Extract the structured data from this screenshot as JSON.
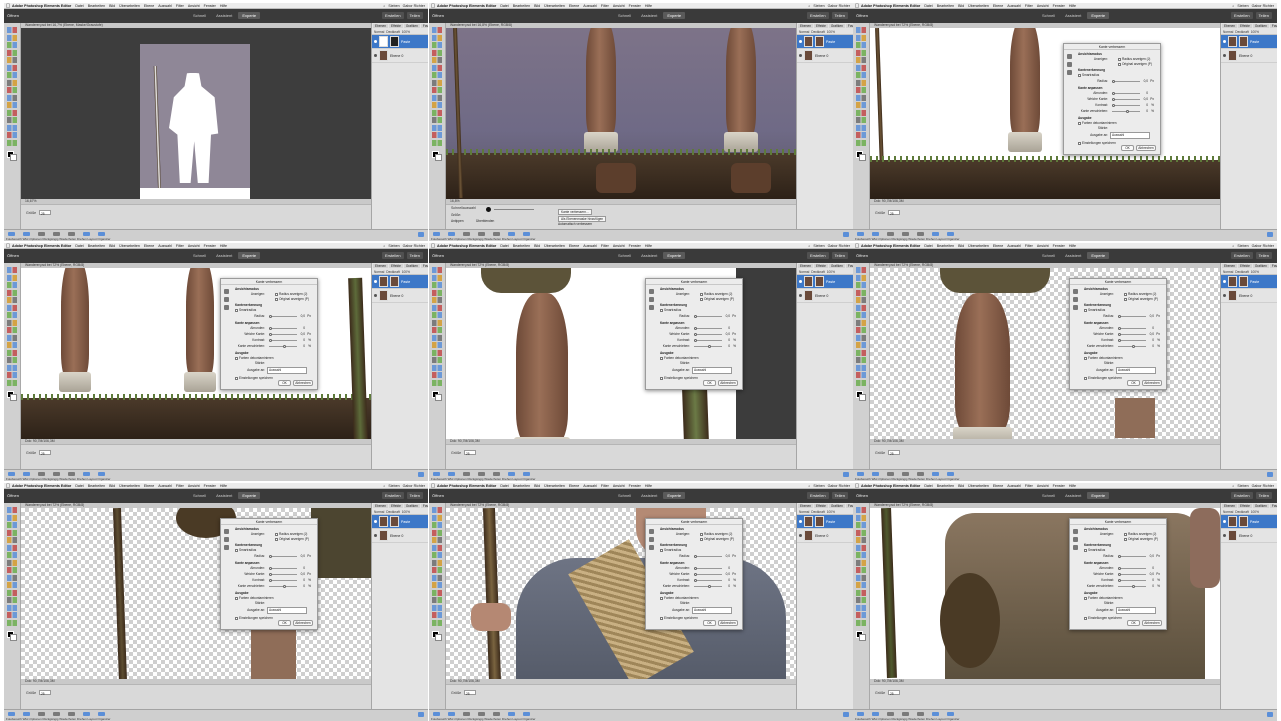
{
  "app": {
    "menu": [
      "Adobe Photoshop Elements Editor",
      "Datei",
      "Bearbeiten",
      "Bild",
      "Überarbeiten",
      "Ebene",
      "Auswahl",
      "Filter",
      "Ansicht",
      "Fenster",
      "Hilfe"
    ],
    "menu_right": [
      "Sieben",
      "Gabor Richter"
    ],
    "open_label": "Öffnen",
    "modes": [
      "Schnell",
      "Assistent",
      "Experte"
    ],
    "active_mode": "Experte",
    "right_actions": [
      "Erstellen",
      "Teilen"
    ],
    "panel_tabs": [
      "Ebenen",
      "Effekte",
      "Grafiken",
      "Favoriten"
    ],
    "layer_tools": [
      "Normal",
      "Deckkraft",
      "100%"
    ],
    "layers": [
      {
        "name": "Paste"
      },
      {
        "name": "Ebene 0"
      }
    ],
    "taskbar_labels": "Fotobereich  Wkz-Optionen  Rückgängig  Wiederholen  Drehen  Layout  Organizer",
    "colors": {
      "selection": "#3d78c8",
      "modebar": "#3a3a3a"
    }
  },
  "panels": [
    {
      "id": 1,
      "doc_title": "Wanderer.psd bei 16,7% (Ebene, Maske/Graustufe)",
      "status": "16,67%",
      "options_label": "Größe",
      "options_value": "25"
    },
    {
      "id": 2,
      "doc_title": "Wanderer.psd bei 16,8% (Ebene, RGB/8)",
      "status": "16,8%",
      "options_label": "Schnellauswahl",
      "options_value": "",
      "options_extra": [
        "Größe:",
        "Antippen",
        "Überblenden",
        "Kante verbessern...",
        "Als Ebenenmaske hinzufügen",
        "Automatisch verbessern"
      ]
    },
    {
      "id": 3,
      "doc_title": "Wanderer.psd bei 72% (Ebene, RGB/8)",
      "status": "Dok: 90,7M/106,3M",
      "options_label": "Größe",
      "options_value": "25"
    },
    {
      "id": 4,
      "doc_title": "Wanderer.psd bei 72% (Ebene, RGB/8)",
      "status": "Dok: 90,7M/106,3M",
      "options_label": "Größe",
      "options_value": "25"
    },
    {
      "id": 5,
      "doc_title": "Wanderer.psd bei 72% (Ebene, RGB/8)",
      "status": "Dok: 90,7M/106,3M",
      "options_label": "Größe",
      "options_value": "25"
    },
    {
      "id": 6,
      "doc_title": "Wanderer.psd bei 72% (Ebene, RGB/8)",
      "status": "Dok: 90,7M/106,3M",
      "options_label": "Größe",
      "options_value": "25"
    },
    {
      "id": 7,
      "doc_title": "Wanderer.psd bei 72% (Ebene, RGB/8)",
      "status": "Dok: 90,7M/106,3M",
      "options_label": "Größe",
      "options_value": "25"
    },
    {
      "id": 8,
      "doc_title": "Wanderer.psd bei 72% (Ebene, RGB/8)",
      "status": "Dok: 90,7M/106,3M",
      "options_label": "Größe",
      "options_value": "25"
    },
    {
      "id": 9,
      "doc_title": "Wanderer.psd bei 72% (Ebene, RGB/8)",
      "status": "Dok: 90,7M/106,3M",
      "options_label": "Größe",
      "options_value": "25"
    }
  ],
  "dialog": {
    "title": "Kante verbessern",
    "sections": {
      "view": "Ansichtsmodus",
      "view_label": "Anzeigen:",
      "radius_show": "Radius anzeigen (J)",
      "orig_show": "Original anzeigen (P)",
      "edge": "Kantenerkennung",
      "smart_radius": "Smartradius",
      "radius": "Radius:",
      "adjust": "Kante anpassen",
      "smooth": "Abrunden:",
      "feather": "Weiche Kante:",
      "contrast": "Kontrast:",
      "shift": "Kante verschieben:",
      "output": "Ausgabe",
      "decontaminate": "Farben dekontaminieren",
      "amount": "Stärke:",
      "output_to": "Ausgabe an:",
      "output_value": "Auswahl",
      "remember": "Einstellungen speichern",
      "ok": "OK",
      "cancel": "Abbrechen"
    },
    "values": {
      "radius": "0,0",
      "radius_unit": "Px",
      "smooth": "0",
      "feather": "0,0",
      "feather_unit": "Px",
      "contrast": "0",
      "contrast_unit": "%",
      "shift": "0",
      "shift_unit": "%"
    }
  }
}
